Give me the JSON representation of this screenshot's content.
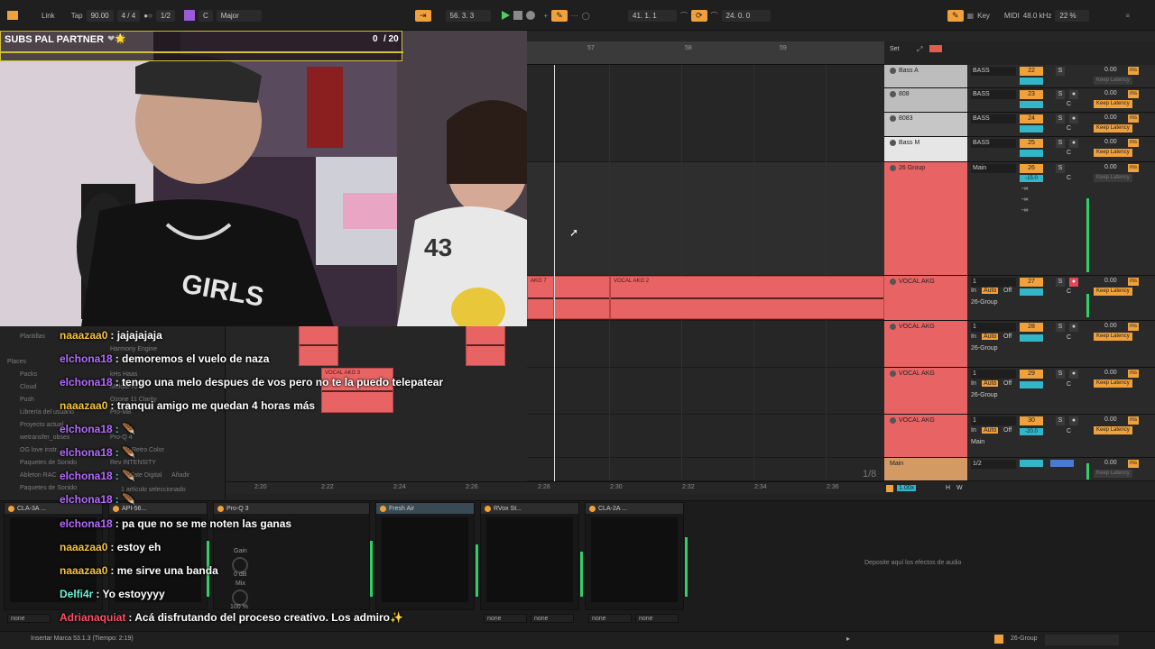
{
  "topbar": {
    "link": "Link",
    "tap": "Tap",
    "tempo": "90.00",
    "signature": "4 / 4",
    "quantize": "1/2",
    "key": "C",
    "scale": "Major",
    "position": "56.  3.  3",
    "loop_start": "41.  1.  1",
    "loop_length": "24.  0.  0",
    "key_label": "Key",
    "midi_label": "MIDI",
    "sample_rate": "48.0 kHz",
    "cpu": "22 %"
  },
  "stream": {
    "goal_label": "SUBS PAL PARTNER",
    "goal_count": "0",
    "goal_total": "/ 20"
  },
  "ruler": {
    "marks": [
      "57",
      "58",
      "59"
    ]
  },
  "set_label": "Set",
  "time_ticks": [
    "2:20",
    "2:22",
    "2:24",
    "2:26",
    "2:28",
    "2:30",
    "2:32",
    "2:34",
    "2:36"
  ],
  "zoom_fraction": "1/8",
  "clips": {
    "vocal_akg_7": "AKG 7",
    "vocal_akg_2": "VOCAL AKG 2",
    "vocal_akg_3": "VOCAL AKG 3"
  },
  "tracks": [
    {
      "name": "Bass A",
      "route": "BASS",
      "num": "22",
      "db": "0.00"
    },
    {
      "name": "808",
      "route": "BASS",
      "num": "23",
      "db": "0.00"
    },
    {
      "name": "8083",
      "route": "BASS",
      "num": "24",
      "db": "0.00"
    },
    {
      "name": "Bass M",
      "route": "BASS",
      "num": "25",
      "db": "0.00"
    },
    {
      "name": "26 Group",
      "route": "Main",
      "num": "26",
      "db": "0.00",
      "vol": "-15.0"
    },
    {
      "name": "VOCAL AKG",
      "route": "1",
      "num": "27",
      "db": "0.00"
    },
    {
      "name": "VOCAL AKG",
      "route": "1",
      "num": "28",
      "db": "0.00"
    },
    {
      "name": "VOCAL AKG",
      "route": "1",
      "num": "29",
      "db": "0.00"
    },
    {
      "name": "VOCAL AKG",
      "route": "1",
      "num": "30",
      "db": "0.00",
      "vol": "-20.0"
    },
    {
      "name": "Main",
      "route": "1/2",
      "db": "0.00"
    }
  ],
  "mixer": {
    "keep_latency": "Keep Latency",
    "ms": "ms",
    "s": "S",
    "c": "C",
    "in": "In",
    "auto": "Auto",
    "off": "Off",
    "group_route": "26-Group",
    "main_route": "Main",
    "ninf": "-∞"
  },
  "bottom_zoom": "1.00x",
  "devices": [
    {
      "name": "CLA-3A ..."
    },
    {
      "name": "API-56..."
    },
    {
      "name": "Pro-Q 3"
    },
    {
      "name": "Fresh Air"
    },
    {
      "name": "RVox St..."
    },
    {
      "name": "CLA-2A ..."
    }
  ],
  "device_params": {
    "gain": "Gain",
    "mix": "Mix",
    "db": "0 dB",
    "pct": "100 %"
  },
  "none_label": "none",
  "drop_fx": "Deposite aquí los efectos de audio",
  "status": {
    "left": "Insertar Marca 53.1.3 (Tiempo: 2:19)",
    "right_track": "26-Group"
  },
  "browser": {
    "items": [
      "Plantillas",
      "Places",
      "Packs",
      "Cloud",
      "Push",
      "Librería del usuario",
      "Proyecto actual",
      "wetransfer_obses",
      "OG love instr...",
      "Paquetes de Sonido",
      "Ableton RAC",
      "Paquetes de Sonido"
    ],
    "plugins": [
      "Harmony Engine",
      "kHs Haas",
      "MeldaPro",
      "Ozone 11 Clarity",
      "Pro-MB",
      "Pro-Q 4",
      "Retro Color",
      "Rev INTENSITY",
      "Slate Digital"
    ],
    "selected": "1 artículo seleccionado",
    "add": "Añadir"
  },
  "chat": [
    {
      "user": "naaazaa0",
      "color": "#f5c242",
      "msg": ": jajajajaja"
    },
    {
      "user": "elchona18",
      "color": "#b46cff",
      "msg": ": demoremos el vuelo de naza"
    },
    {
      "user": "elchona18",
      "color": "#b46cff",
      "msg": ": tengo una melo despues de vos pero no te la puedo telepatear"
    },
    {
      "user": "naaazaa0",
      "color": "#f5c242",
      "msg": ": tranqui amigo me quedan 4 horas más"
    },
    {
      "user": "elchona18",
      "color": "#b46cff",
      "msg": ": 🪶"
    },
    {
      "user": "elchona18",
      "color": "#b46cff",
      "msg": ": 🪶"
    },
    {
      "user": "elchona18",
      "color": "#b46cff",
      "msg": ": 🪶"
    },
    {
      "user": "elchona18",
      "color": "#b46cff",
      "msg": ": 🪶"
    },
    {
      "user": "elchona18",
      "color": "#b46cff",
      "msg": ": pa que no se me noten las ganas"
    },
    {
      "user": "naaazaa0",
      "color": "#f5c242",
      "msg": ": estoy eh"
    },
    {
      "user": "naaazaa0",
      "color": "#f5c242",
      "msg": ": me sirve una banda"
    },
    {
      "user": "Delfi4r",
      "color": "#6cf2d8",
      "msg": ": Yo estoyyyy"
    },
    {
      "user": "Adrianaquiat",
      "color": "#ff4f6a",
      "msg": ": Acá disfrutando del proceso creativo. Los admiro✨"
    }
  ],
  "colors": {
    "accent": "#f0a13b",
    "clip": "#e86464",
    "play": "#4fd05a",
    "meter": "#2fcf6a"
  }
}
